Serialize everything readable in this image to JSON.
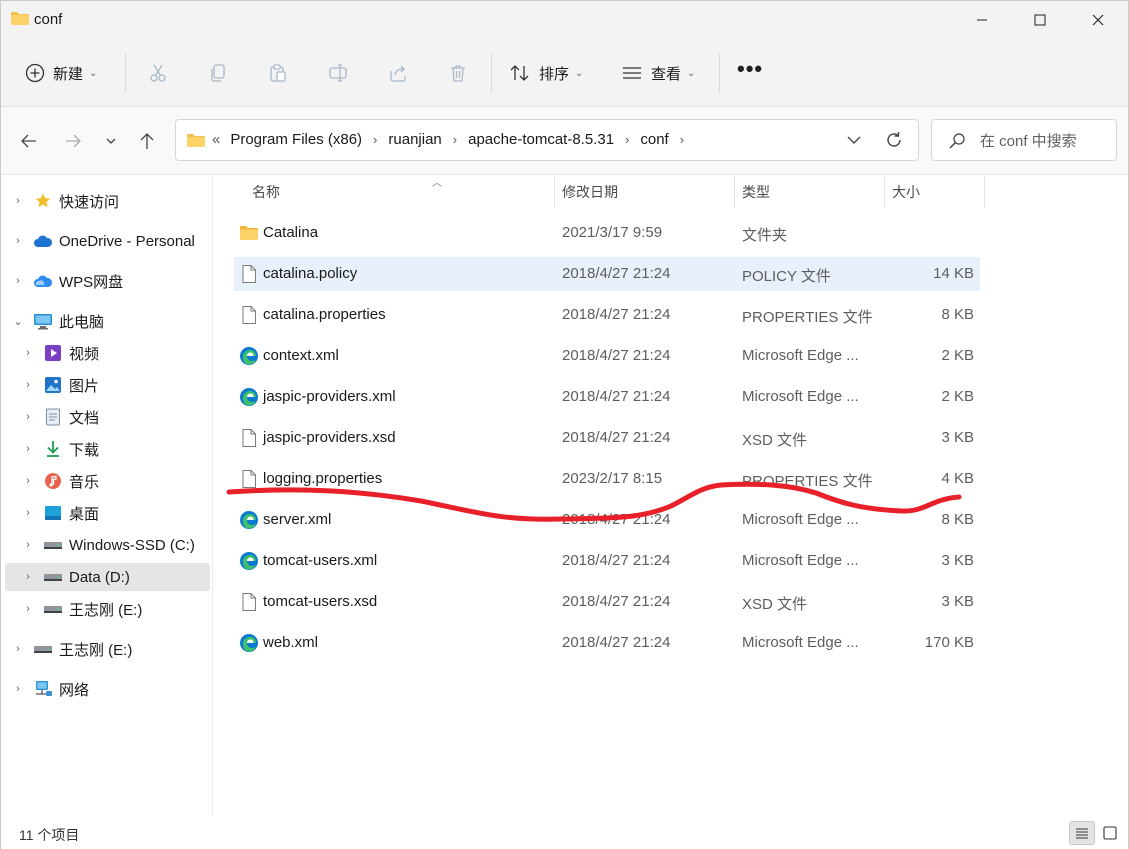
{
  "window": {
    "title": "conf"
  },
  "toolbar": {
    "new_label": "新建",
    "sort_label": "排序",
    "view_label": "查看",
    "more_label": "•••"
  },
  "address": {
    "overflow": "«",
    "crumbs": [
      "Program Files (x86)",
      "ruanjian",
      "apache-tomcat-8.5.31",
      "conf"
    ]
  },
  "search": {
    "placeholder": "在 conf 中搜索"
  },
  "sidebar": {
    "items": [
      {
        "label": "快速访问",
        "icon": "star-icon"
      },
      {
        "label": "OneDrive - Personal",
        "icon": "cloud-icon"
      },
      {
        "label": "WPS网盘",
        "icon": "wps-cloud-icon"
      },
      {
        "label": "此电脑",
        "icon": "computer-icon"
      },
      {
        "label": "视频",
        "icon": "video-icon"
      },
      {
        "label": "图片",
        "icon": "picture-icon"
      },
      {
        "label": "文档",
        "icon": "document-icon"
      },
      {
        "label": "下载",
        "icon": "download-icon"
      },
      {
        "label": "音乐",
        "icon": "music-icon"
      },
      {
        "label": "桌面",
        "icon": "desktop-icon"
      },
      {
        "label": "Windows-SSD (C:)",
        "icon": "drive-icon"
      },
      {
        "label": "Data (D:)",
        "icon": "drive-icon"
      },
      {
        "label": "王志刚 (E:)",
        "icon": "drive-icon"
      },
      {
        "label": "王志刚 (E:)",
        "icon": "drive-icon"
      },
      {
        "label": "网络",
        "icon": "network-icon"
      }
    ]
  },
  "columns": {
    "name": "名称",
    "date": "修改日期",
    "type": "类型",
    "size": "大小"
  },
  "files": [
    {
      "name": "Catalina",
      "date": "2021/3/17 9:59",
      "type": "文件夹",
      "size": "",
      "icon": "folder-icon"
    },
    {
      "name": "catalina.policy",
      "date": "2018/4/27 21:24",
      "type": "POLICY 文件",
      "size": "14 KB",
      "icon": "file-icon"
    },
    {
      "name": "catalina.properties",
      "date": "2018/4/27 21:24",
      "type": "PROPERTIES 文件",
      "size": "8 KB",
      "icon": "file-icon"
    },
    {
      "name": "context.xml",
      "date": "2018/4/27 21:24",
      "type": "Microsoft Edge ...",
      "size": "2 KB",
      "icon": "edge-icon"
    },
    {
      "name": "jaspic-providers.xml",
      "date": "2018/4/27 21:24",
      "type": "Microsoft Edge ...",
      "size": "2 KB",
      "icon": "edge-icon"
    },
    {
      "name": "jaspic-providers.xsd",
      "date": "2018/4/27 21:24",
      "type": "XSD 文件",
      "size": "3 KB",
      "icon": "file-icon"
    },
    {
      "name": "logging.properties",
      "date": "2023/2/17 8:15",
      "type": "PROPERTIES 文件",
      "size": "4 KB",
      "icon": "file-icon"
    },
    {
      "name": "server.xml",
      "date": "2018/4/27 21:24",
      "type": "Microsoft Edge ...",
      "size": "8 KB",
      "icon": "edge-icon"
    },
    {
      "name": "tomcat-users.xml",
      "date": "2018/4/27 21:24",
      "type": "Microsoft Edge ...",
      "size": "3 KB",
      "icon": "edge-icon"
    },
    {
      "name": "tomcat-users.xsd",
      "date": "2018/4/27 21:24",
      "type": "XSD 文件",
      "size": "3 KB",
      "icon": "file-icon"
    },
    {
      "name": "web.xml",
      "date": "2018/4/27 21:24",
      "type": "Microsoft Edge ...",
      "size": "170 KB",
      "icon": "edge-icon"
    }
  ],
  "status": {
    "item_count": "11 个项目"
  },
  "colors": {
    "folder": "#f5c04a",
    "edge": "#0c7ad1",
    "selection": "#e8f1fb",
    "annotation": "#e8202a"
  }
}
